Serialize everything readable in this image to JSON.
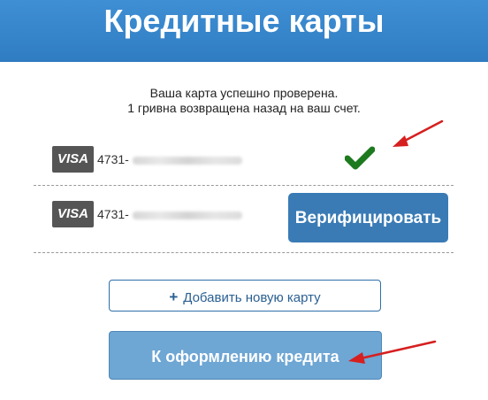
{
  "header": {
    "title": "Кредитные карты"
  },
  "message": {
    "line1": "Ваша карта успешно проверена.",
    "line2": "1 гривна возвращена назад на ваш счет."
  },
  "cards": [
    {
      "brand": "VISA",
      "number": "4731-",
      "status": "verified",
      "status_icon": "checkmark-icon",
      "status_color": "#1e7a1e"
    },
    {
      "brand": "VISA",
      "number": "4731-",
      "action_label": "Верифицировать"
    }
  ],
  "actions": {
    "add_card_icon": "plus-icon",
    "add_card_label": "Добавить новую карту",
    "continue_label": "К оформлению кредита"
  },
  "colors": {
    "header": "#3a88cc",
    "primary_button": "#3a7bb5",
    "credit_button": "#6ea6d4",
    "annotation_arrow": "#d61f1f"
  }
}
